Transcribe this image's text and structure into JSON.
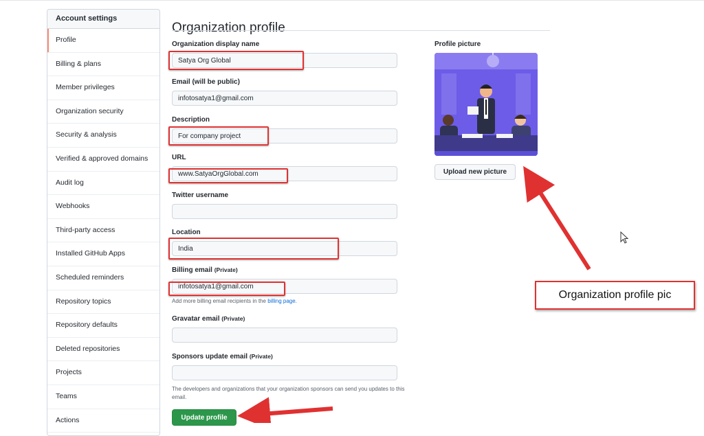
{
  "sidebar": {
    "header": "Account settings",
    "items": [
      {
        "label": "Profile"
      },
      {
        "label": "Billing & plans"
      },
      {
        "label": "Member privileges"
      },
      {
        "label": "Organization security"
      },
      {
        "label": "Security & analysis"
      },
      {
        "label": "Verified & approved domains"
      },
      {
        "label": "Audit log"
      },
      {
        "label": "Webhooks"
      },
      {
        "label": "Third-party access"
      },
      {
        "label": "Installed GitHub Apps"
      },
      {
        "label": "Scheduled reminders"
      },
      {
        "label": "Repository topics"
      },
      {
        "label": "Repository defaults"
      },
      {
        "label": "Deleted repositories"
      },
      {
        "label": "Projects"
      },
      {
        "label": "Teams"
      },
      {
        "label": "Actions"
      }
    ]
  },
  "main": {
    "title": "Organization profile",
    "display_name": {
      "label": "Organization display name",
      "value": "Satya Org Global"
    },
    "email": {
      "label": "Email (will be public)",
      "value": "infotosatya1@gmail.com"
    },
    "description": {
      "label": "Description",
      "value": "For company project"
    },
    "url": {
      "label": "URL",
      "value": "www.SatyaOrgGlobal.com"
    },
    "twitter": {
      "label": "Twitter username",
      "value": ""
    },
    "location": {
      "label": "Location",
      "value": "India"
    },
    "billing_email": {
      "label": "Billing email",
      "tag": "(Private)",
      "value": "infotosatya1@gmail.com",
      "hint_prefix": "Add more billing email recipients in the ",
      "hint_link": "billing page",
      "hint_suffix": "."
    },
    "gravatar_email": {
      "label": "Gravatar email",
      "tag": "(Private)",
      "value": ""
    },
    "sponsors_email": {
      "label": "Sponsors update email",
      "tag": "(Private)",
      "value": "",
      "hint": "The developers and organizations that your organization sponsors can send you updates to this email."
    },
    "update_button": "Update profile"
  },
  "profile_picture": {
    "label": "Profile picture",
    "upload_button": "Upload new picture"
  },
  "annotation": {
    "callout": "Organization profile pic",
    "color": "#e03131"
  },
  "colors": {
    "accent_green": "#2c974b",
    "link_blue": "#0969da",
    "image_purple": "#6d5ce8"
  }
}
